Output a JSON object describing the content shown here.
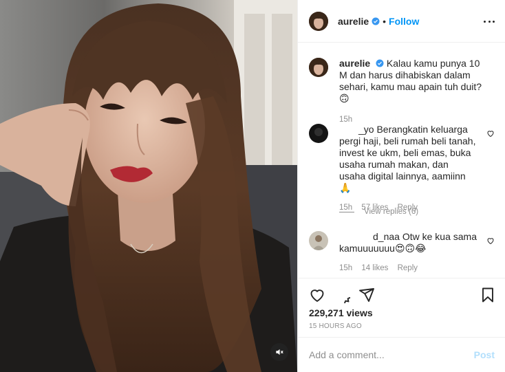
{
  "post": {
    "username": "aurelie",
    "follow_label": "Follow",
    "separator": "•"
  },
  "caption": {
    "username": "aurelie",
    "text": "Kalau kamu punya 10 M dan harus dihabiskan dalam sehari, kamu mau apain tuh duit? 🙃",
    "time": "15h"
  },
  "comments": [
    {
      "username_visible": "_yo",
      "text": "Berangkatin keluarga pergi haji, beli rumah beli tanah, invest ke ukm, beli emas, buka usaha rumah makan, dan usaha digital lainnya, aamiinn 🙏",
      "time": "15h",
      "likes": "57 likes",
      "reply_label": "Reply"
    },
    {
      "username_visible": "d_naa",
      "text": "Otw ke kua sama kamuuuuuuu😍🙃😂",
      "time": "15h",
      "likes": "14 likes",
      "reply_label": "Reply"
    }
  ],
  "view_replies": "View replies (6)",
  "stats": {
    "views": "229,271 views",
    "time_ago": "15 HOURS AGO"
  },
  "composer": {
    "placeholder": "Add a comment...",
    "post_label": "Post"
  },
  "colors": {
    "link_blue": "#0095f6",
    "post_disabled": "#b2dffc",
    "muted_text": "#8e8e8e",
    "border": "#efefef"
  },
  "icons": [
    "volume-mute-icon",
    "more-options-icon",
    "verified-badge-icon",
    "heart-icon",
    "comment-icon",
    "share-icon",
    "bookmark-icon"
  ]
}
